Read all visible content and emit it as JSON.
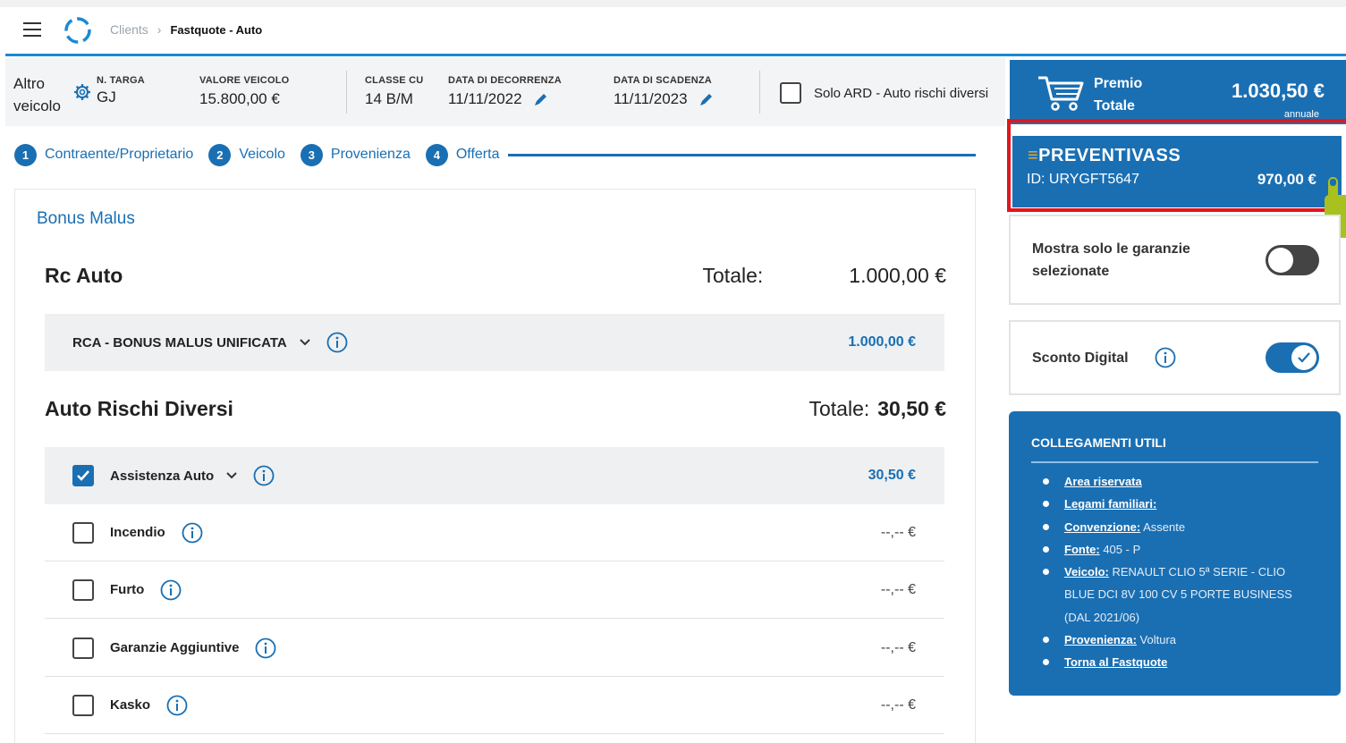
{
  "header": {
    "breadcrumb": {
      "parent": "Clients",
      "current": "Fastquote - Auto"
    }
  },
  "vehicle_info": {
    "altro_line1": "Altro",
    "altro_line2": "veicolo",
    "targa": {
      "label": "N. TARGA",
      "value": "GJ"
    },
    "valore": {
      "label": "VALORE VEICOLO",
      "value": "15.800,00 €"
    },
    "classe": {
      "label": "CLASSE CU",
      "value": "14 B/M"
    },
    "decorrenza": {
      "label": "DATA DI DECORRENZA",
      "value": "11/11/2022"
    },
    "scadenza": {
      "label": "DATA DI SCADENZA",
      "value": "11/11/2023"
    },
    "ard_label": "Solo ARD - Auto rischi diversi"
  },
  "premio": {
    "title_line1": "Premio",
    "title_line2": "Totale",
    "amount": "1.030,50 €",
    "period": "annuale"
  },
  "steps": [
    {
      "num": "1",
      "label": "Contraente/Proprietario"
    },
    {
      "num": "2",
      "label": "Veicolo"
    },
    {
      "num": "3",
      "label": "Provenienza"
    },
    {
      "num": "4",
      "label": "Offerta"
    }
  ],
  "bonus_malus_title": "Bonus Malus",
  "rc_auto": {
    "title": "Rc Auto",
    "total_label": "Totale:",
    "total": "1.000,00 €",
    "row": {
      "label": "RCA - BONUS MALUS UNIFICATA",
      "amount": "1.000,00 €"
    }
  },
  "ard": {
    "title": "Auto Rischi Diversi",
    "total_label": "Totale:",
    "total": "30,50 €",
    "rows": [
      {
        "label": "Assistenza Auto",
        "amount": "30,50 €",
        "checked": true
      },
      {
        "label": "Incendio",
        "amount": "--,-- €",
        "checked": false
      },
      {
        "label": "Furto",
        "amount": "--,-- €",
        "checked": false
      },
      {
        "label": "Garanzie Aggiuntive",
        "amount": "--,-- €",
        "checked": false
      },
      {
        "label": "Kasko",
        "amount": "--,-- €",
        "checked": false
      }
    ]
  },
  "preventivass": {
    "brand": "PREVENTIVASS",
    "id": "ID: URYGFT5647",
    "amount": "970,00 €"
  },
  "toggles": {
    "mostra": {
      "line1": "Mostra solo le garanzie",
      "line2": "selezionate",
      "state": "off"
    },
    "sconto": {
      "label": "Sconto Digital",
      "state": "on"
    }
  },
  "links": {
    "title": "COLLEGAMENTI UTILI",
    "items": [
      {
        "link": "Area riservata",
        "value": ""
      },
      {
        "link": "Legami familiari:",
        "value": ""
      },
      {
        "link": "Convenzione:",
        "value": " Assente"
      },
      {
        "link": "Fonte:",
        "value": " 405 - P"
      },
      {
        "link": "Veicolo:",
        "value": " RENAULT CLIO 5ª SERIE - CLIO BLUE DCI 8V 100 CV 5 PORTE BUSINESS (DAL 2021/06)"
      },
      {
        "link": "Provenienza:",
        "value": " Voltura"
      },
      {
        "link": "Torna al Fastquote",
        "value": ""
      }
    ]
  },
  "colors": {
    "primary_blue": "#1a6fb3",
    "highlight_red": "#e2161d",
    "brand_accent": "#f5a623"
  }
}
